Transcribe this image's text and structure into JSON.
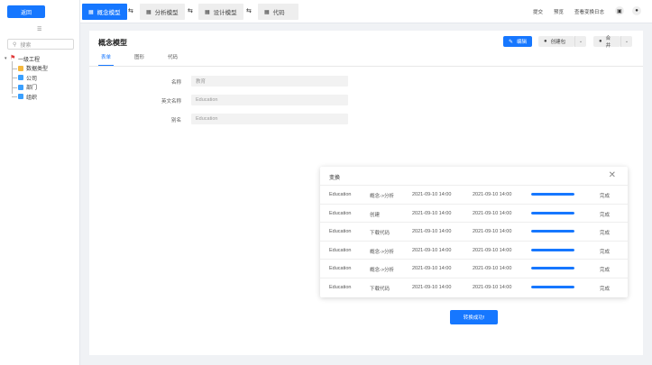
{
  "left": {
    "back_label": "返回",
    "search_placeholder": "搜索",
    "tree": {
      "root": "一级工程",
      "children": [
        "数据类型",
        "公司",
        "部门",
        "组织"
      ]
    }
  },
  "topbar": {
    "tabs": [
      {
        "label": "概念模型",
        "active": true
      },
      {
        "label": "分析模型",
        "active": false
      },
      {
        "label": "设计模型",
        "active": false
      },
      {
        "label": "代码",
        "active": false
      }
    ],
    "links": [
      "提交",
      "预览",
      "查看变换日志"
    ]
  },
  "page": {
    "title": "概念模型",
    "subtabs": [
      "表单",
      "图形",
      "代码"
    ],
    "active_subtab": "表单",
    "actions": {
      "edit": "编辑",
      "create": "创建包",
      "merge": "合并"
    },
    "form": [
      {
        "label": "名称",
        "value": "教育"
      },
      {
        "label": "英文名称",
        "value": "Education"
      },
      {
        "label": "别名",
        "value": "Education"
      }
    ]
  },
  "modal": {
    "title": "变换",
    "rows": [
      {
        "name": "Education",
        "op": "概念->分析",
        "start": "2021-09-10  14:00",
        "end": "2021-09-10  14:00",
        "progress": 1.0,
        "status": "完成"
      },
      {
        "name": "Education",
        "op": "创建",
        "start": "2021-09-10  14:00",
        "end": "2021-09-10  14:00",
        "progress": 1.0,
        "status": "完成"
      },
      {
        "name": "Education",
        "op": "下载代码",
        "start": "2021-09-10  14:00",
        "end": "2021-09-10  14:00",
        "progress": 1.0,
        "status": "完成"
      },
      {
        "name": "Education",
        "op": "概念->分析",
        "start": "2021-09-10  14:00",
        "end": "2021-09-10  14:00",
        "progress": 1.0,
        "status": "完成"
      },
      {
        "name": "Education",
        "op": "概念->分析",
        "start": "2021-09-10  14:00",
        "end": "2021-09-10  14:00",
        "progress": 1.0,
        "status": "完成"
      },
      {
        "name": "Education",
        "op": "下载代码",
        "start": "2021-09-10  14:00",
        "end": "2021-09-10  14:00",
        "progress": 1.0,
        "status": "完成"
      }
    ]
  },
  "success_label": "转换成功!",
  "colors": {
    "accent": "#1677ff"
  }
}
